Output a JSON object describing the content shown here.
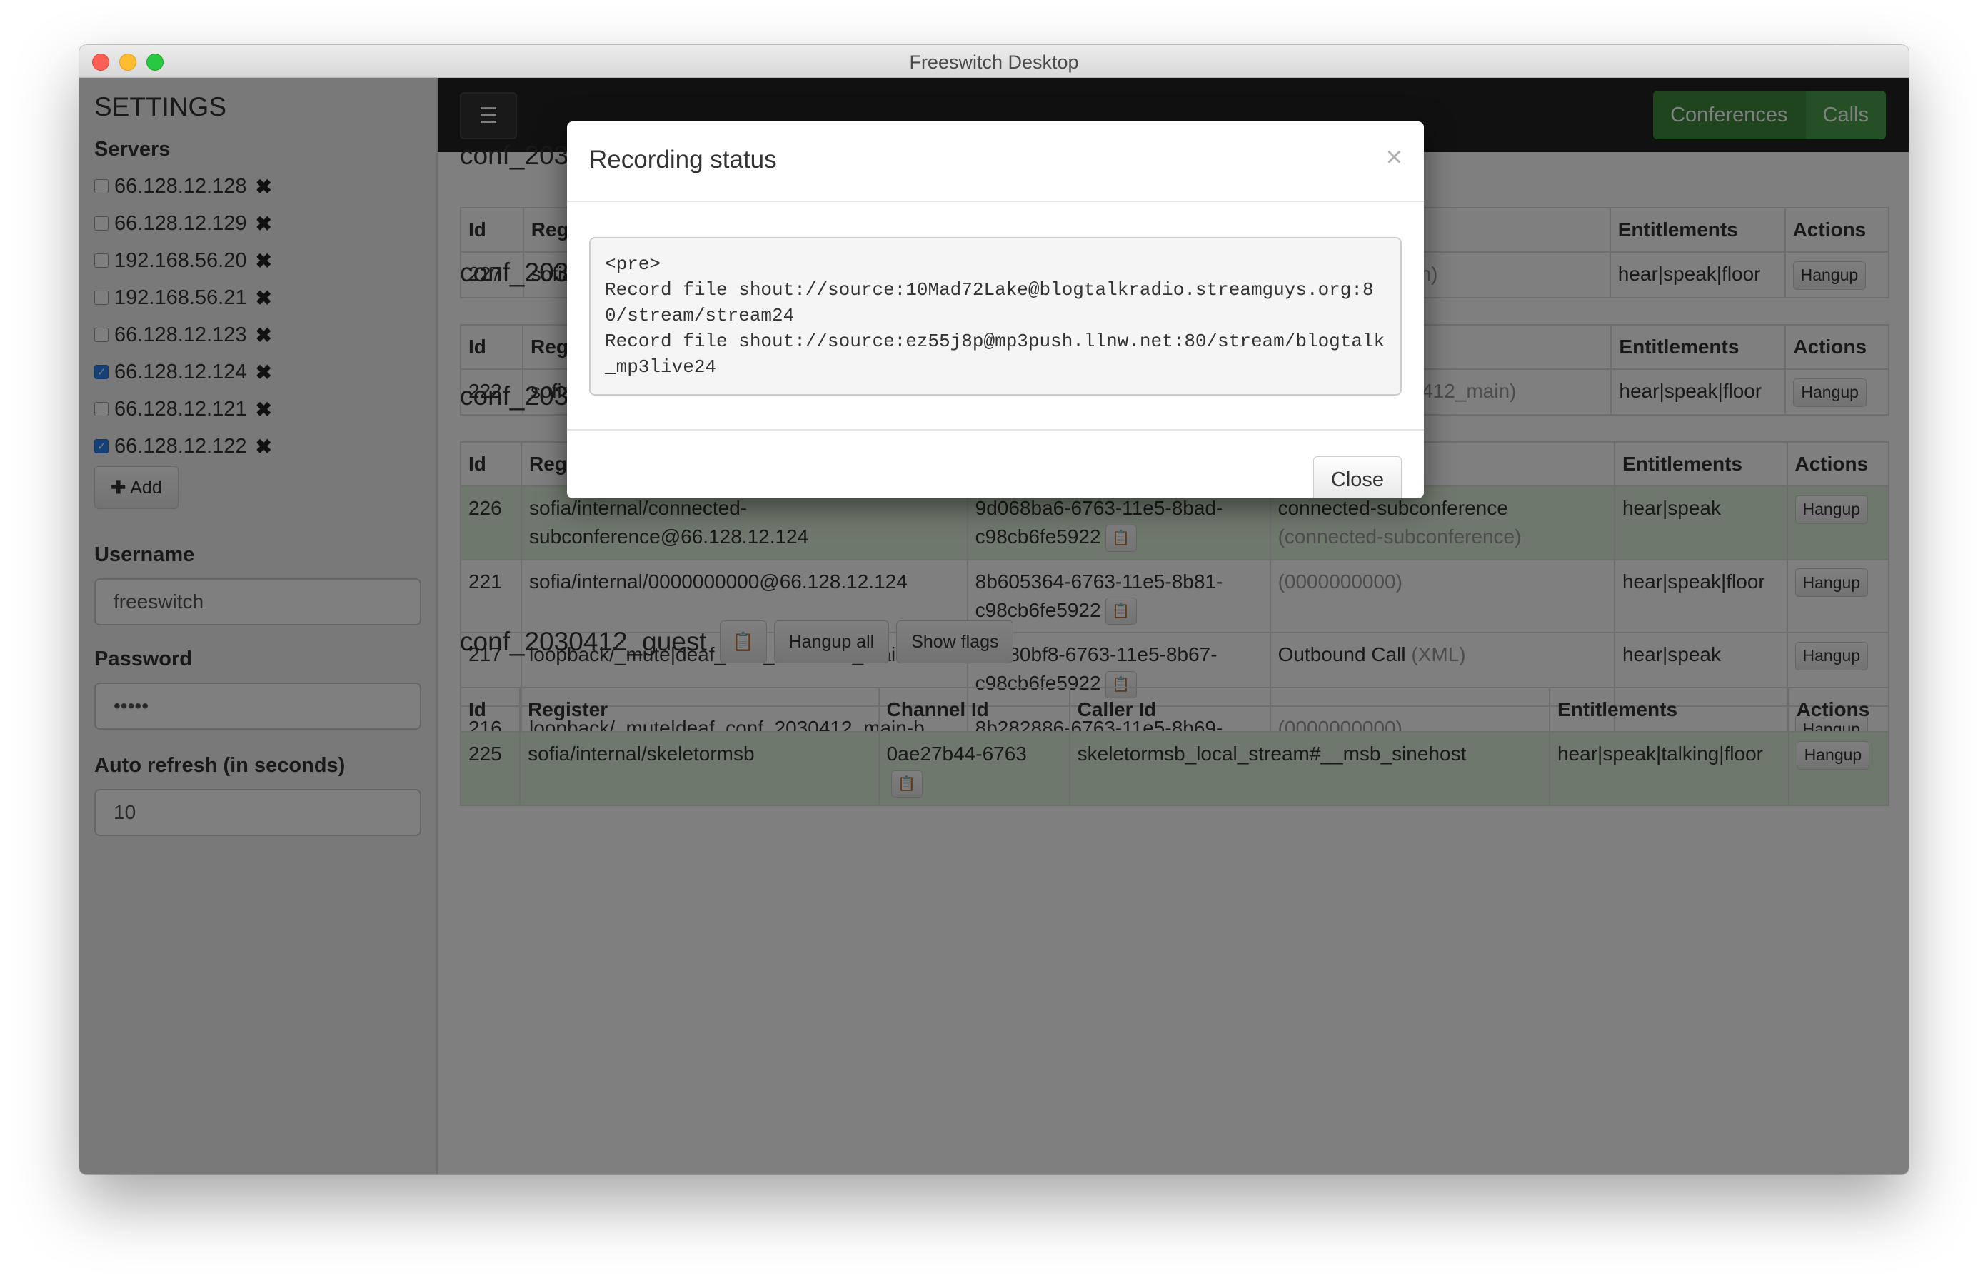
{
  "window": {
    "title": "Freeswitch Desktop"
  },
  "sidebar": {
    "title": "SETTINGS",
    "servers_label": "Servers",
    "servers": [
      {
        "ip": "66.128.12.128",
        "checked": false
      },
      {
        "ip": "66.128.12.129",
        "checked": false
      },
      {
        "ip": "192.168.56.20",
        "checked": false
      },
      {
        "ip": "192.168.56.21",
        "checked": false
      },
      {
        "ip": "66.128.12.123",
        "checked": false
      },
      {
        "ip": "66.128.12.124",
        "checked": true
      },
      {
        "ip": "66.128.12.121",
        "checked": false
      },
      {
        "ip": "66.128.12.122",
        "checked": true
      }
    ],
    "add_label": "Add",
    "username_label": "Username",
    "username_value": "freeswitch",
    "password_label": "Password",
    "password_value": "•••••",
    "refresh_label": "Auto refresh (in seconds)",
    "refresh_value": "10"
  },
  "navbar": {
    "conferences_label": "Conferences",
    "calls_label": "Calls"
  },
  "headers": {
    "id": "Id",
    "register": "Register",
    "channel_id": "Channel Id",
    "caller_id": "Caller Id",
    "entitlements": "Entitlements",
    "actions": "Actions"
  },
  "conferences": [
    {
      "title": "conf_203",
      "rows": [
        {
          "id": "227",
          "register": "sofia/",
          "channel": "",
          "caller": "412_main",
          "caller_extra": "412_main)",
          "entitlements": "hear|speak|floor",
          "action": "Hangup"
        }
      ]
    },
    {
      "title": "conf_203",
      "rows": [
        {
          "id": "222",
          "register": "sofia/",
          "channel": "c98cb6fe5922",
          "caller": "12_main",
          "caller_extra": "(conf_2030412_main)",
          "entitlements": "hear|speak|floor",
          "action": "Hangup"
        }
      ]
    },
    {
      "title": "conf_2030412_main",
      "buttons": [
        "Hangup all",
        "Show flags",
        "Recording status"
      ],
      "rows": [
        {
          "id": "226",
          "register": "sofia/internal/connected-subconference@66.128.12.124",
          "channel": "9d068ba6-6763-11e5-8bad-c98cb6fe5922",
          "caller": "connected-subconference",
          "caller_extra": "(connected-subconference)",
          "entitlements": "hear|speak",
          "action": "Hangup"
        },
        {
          "id": "221",
          "register": "sofia/internal/0000000000@66.128.12.124",
          "channel": "8b605364-6763-11e5-8b81-c98cb6fe5922",
          "caller": "",
          "caller_extra": "(0000000000)",
          "entitlements": "hear|speak|floor",
          "action": "Hangup"
        },
        {
          "id": "217",
          "register": "loopback/_mute|deaf_conf_2030412_main-a",
          "channel": "8b280bf8-6763-11e5-8b67-c98cb6fe5922",
          "caller": "Outbound Call",
          "caller_extra": "(XML)",
          "entitlements": "hear|speak",
          "action": "Hangup"
        },
        {
          "id": "216",
          "register": "loopback/_mute|deaf_conf_2030412_main-b",
          "channel": "8b282886-6763-11e5-8b69-c98cb6fe5922",
          "caller": "",
          "caller_extra": "(0000000000)",
          "entitlements": "",
          "action": "Hangup"
        }
      ]
    },
    {
      "title": "conf_2030412_guest",
      "buttons": [
        "Hangup all",
        "Show flags"
      ],
      "rows": [
        {
          "id": "225",
          "register": "sofia/internal/skeletormsb",
          "channel": "0ae27b44-6763",
          "caller": "skeletormsb_local_stream#__msb_sinehost",
          "caller_extra": "",
          "entitlements": "hear|speak|talking|floor",
          "action": "Hangup"
        }
      ]
    }
  ],
  "modal": {
    "title": "Recording status",
    "close_x": "×",
    "pre_text": "<pre>\nRecord file shout://source:10Mad72Lake@blogtalkradio.streamguys.org:80/stream/stream24\nRecord file shout://source:ez55j8p@mp3push.llnw.net:80/stream/blogtalk_mp3live24",
    "close_label": "Close"
  },
  "colors": {
    "navbar": "#222222",
    "nav_button": "#4aa04a",
    "success_row": "#dff0d8",
    "checkbox_checked": "#2a83f0"
  }
}
